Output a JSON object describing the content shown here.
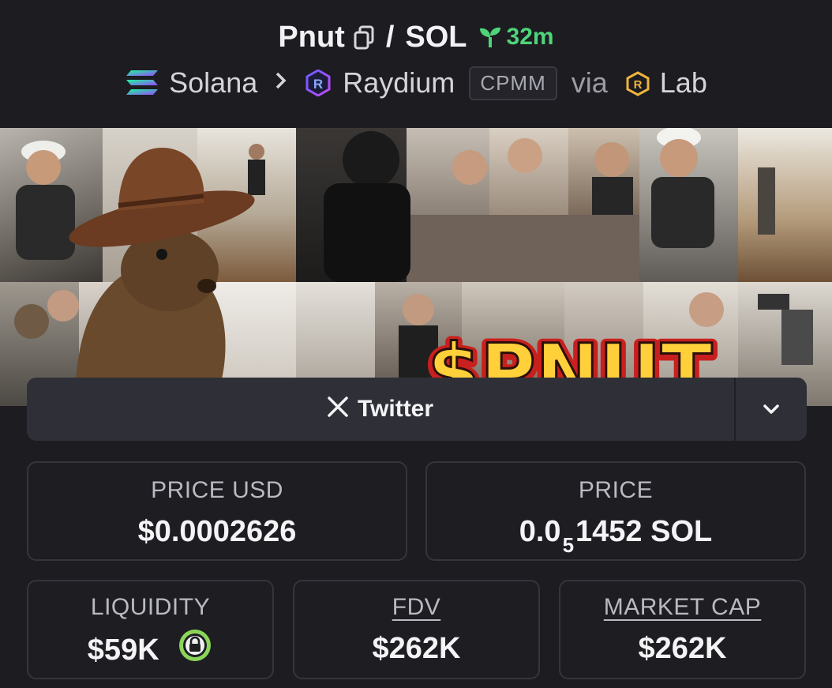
{
  "header": {
    "token": "Pnut",
    "separator": "/",
    "quote": "SOL",
    "age": "32m",
    "chain": "Solana",
    "dex": "Raydium",
    "pool_type": "CPMM",
    "via_label": "via",
    "launchpad": "Lab"
  },
  "banner": {
    "title_text": "$PNUT"
  },
  "social": {
    "twitter_label": "Twitter"
  },
  "stats": {
    "price_usd_label": "PRICE USD",
    "price_usd_value": "$0.0002626",
    "price_label": "PRICE",
    "price_prefix": "0.0",
    "price_subscript": "5",
    "price_digits": "1452",
    "price_unit": "SOL",
    "liquidity_label": "LIQUIDITY",
    "liquidity_value": "$59K",
    "fdv_label": "FDV",
    "fdv_value": "$262K",
    "mcap_label": "MARKET CAP",
    "mcap_value": "$262K"
  },
  "colors": {
    "background": "#1c1c21",
    "age_green": "#4fd47a",
    "lock_green": "#8bd65a",
    "card_border": "#35353d"
  },
  "icons": [
    "copy-icon",
    "seedling-icon",
    "solana-icon",
    "chevron-right-icon",
    "raydium-icon",
    "lab-icon",
    "x-logo-icon",
    "chevron-down-icon",
    "lock-icon"
  ]
}
